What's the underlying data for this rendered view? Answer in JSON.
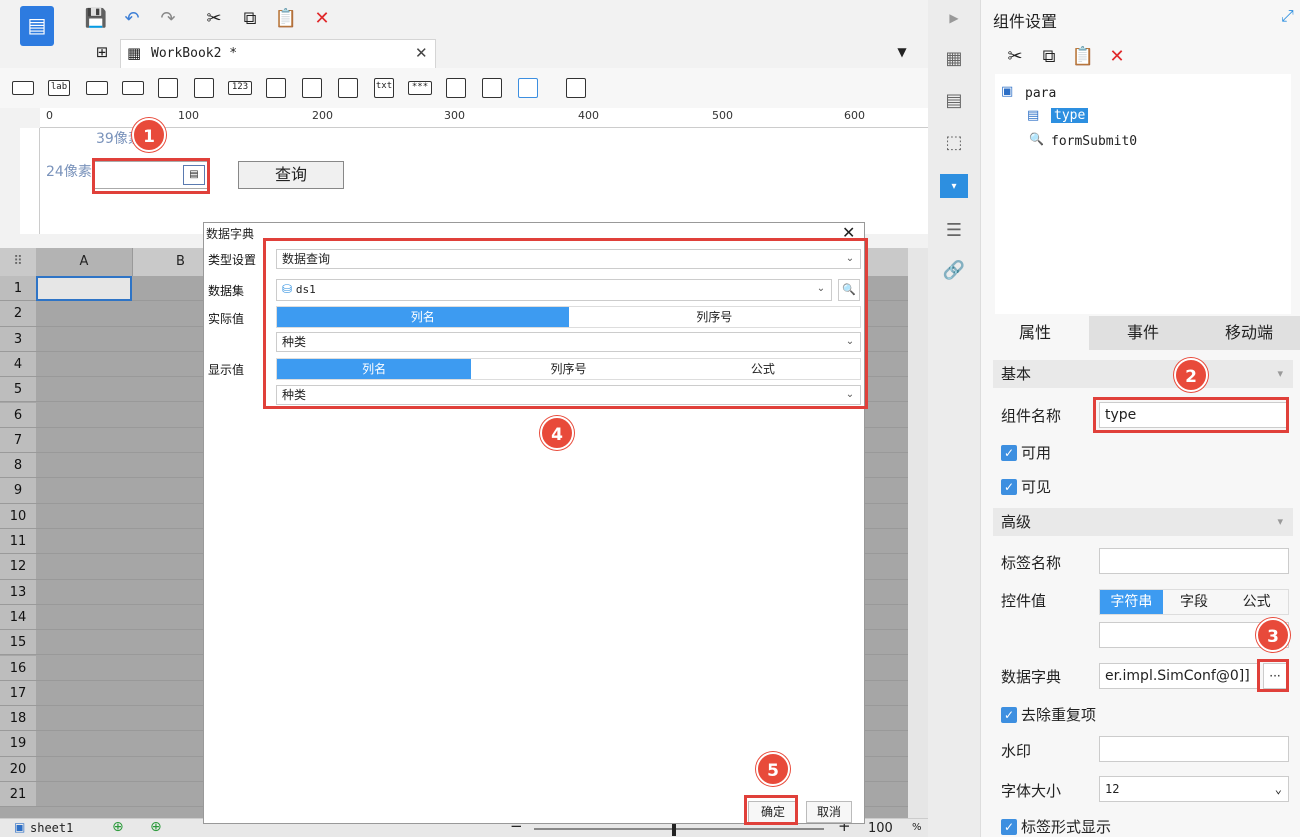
{
  "toolbar": {
    "icons": [
      "logo-icon",
      "save-icon",
      "undo-icon",
      "redo-icon",
      "cut-icon",
      "copy-icon",
      "paste-icon",
      "delete-icon"
    ],
    "workbook_tab": "WorkBook2 *"
  },
  "widgets": [
    "lab",
    "123",
    "txt",
    "***"
  ],
  "ruler": {
    "marks": [
      "0",
      "100",
      "200",
      "300",
      "400",
      "500",
      "600"
    ]
  },
  "param_pane": {
    "top_margin": "39像素",
    "left_margin": "24像素",
    "query_button": "查询"
  },
  "sheet": {
    "columns": [
      "A",
      "B"
    ],
    "rows": [
      "1",
      "2",
      "3",
      "4",
      "5",
      "6",
      "7",
      "8",
      "9",
      "10",
      "11",
      "12",
      "13",
      "14",
      "15",
      "16",
      "17",
      "18",
      "19",
      "20",
      "21"
    ],
    "tab": "sheet1",
    "zoom": "100",
    "zoom_unit": "%"
  },
  "dialog": {
    "title": "数据字典",
    "type_label": "类型设置",
    "type_value": "数据查询",
    "dataset_label": "数据集",
    "dataset_value": "ds1",
    "actual_label": "实际值",
    "actual_seg": [
      "列名",
      "列序号"
    ],
    "actual_value": "种类",
    "display_label": "显示值",
    "display_seg": [
      "列名",
      "列序号",
      "公式"
    ],
    "display_value": "种类",
    "ok": "确定",
    "cancel": "取消"
  },
  "callouts": [
    "1",
    "2",
    "3",
    "4",
    "5"
  ],
  "right_panel": {
    "title": "组件设置",
    "tree": [
      "para",
      "type",
      "formSubmit0"
    ],
    "tabs": [
      "属性",
      "事件",
      "移动端"
    ],
    "basic": "基本",
    "name_label": "组件名称",
    "name_value": "type",
    "enabled": "可用",
    "visible": "可见",
    "advanced": "高级",
    "tag_label": "标签名称",
    "control_value_label": "控件值",
    "cv_seg": [
      "字符串",
      "字段",
      "公式"
    ],
    "dict_label": "数据字典",
    "dict_value": "er.impl.SimConf@0]]",
    "dict_btn": "···",
    "dedupe": "去除重复项",
    "watermark": "水印",
    "font_size_label": "字体大小",
    "font_size_value": "12",
    "tag_display": "标签形式显示"
  }
}
